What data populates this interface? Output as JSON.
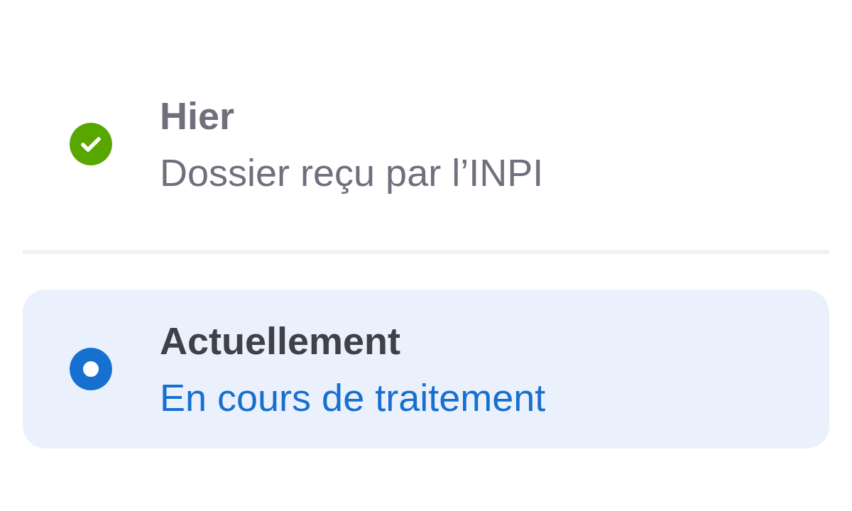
{
  "timeline": {
    "steps": [
      {
        "kind": "done",
        "title": "Hier",
        "status": "Dossier reçu par l’INPI",
        "selected": false
      },
      {
        "kind": "current",
        "title": "Actuellement",
        "status": "En cours de traitement",
        "selected": true
      }
    ]
  }
}
